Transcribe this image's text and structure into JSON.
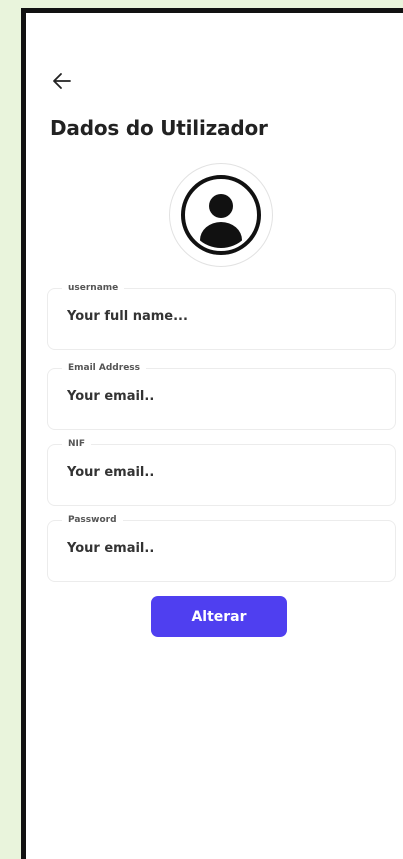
{
  "header": {
    "back_icon": "arrow-left-icon",
    "title": "Dados do Utilizador"
  },
  "avatar": {
    "icon": "user-icon"
  },
  "form": {
    "fields": [
      {
        "label": "username",
        "placeholder": "Your full name..."
      },
      {
        "label": "Email Address",
        "placeholder": "Your email.."
      },
      {
        "label": "NIF",
        "placeholder": "Your email.."
      },
      {
        "label": "Password",
        "placeholder": "Your email.."
      }
    ],
    "submit_label": "Alterar"
  },
  "colors": {
    "accent": "#4f3ff0",
    "background": "#e9f4dc",
    "frame": "#111111"
  }
}
